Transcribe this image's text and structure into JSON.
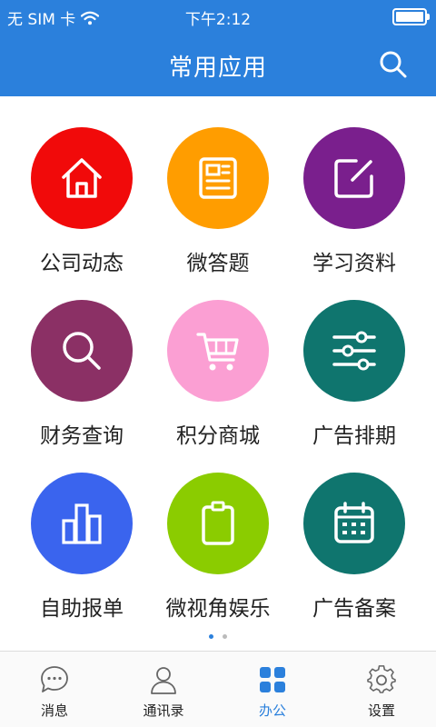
{
  "status_bar": {
    "carrier": "无 SIM 卡",
    "time": "下午2:12",
    "battery_level": 1.0
  },
  "header": {
    "title": "常用应用",
    "search_icon": "search-icon"
  },
  "apps": [
    {
      "label": "公司动态",
      "icon": "home-icon",
      "color": "#f10a0a"
    },
    {
      "label": "微答题",
      "icon": "form-icon",
      "color": "#ff9d00"
    },
    {
      "label": "学习资料",
      "icon": "edit-icon",
      "color": "#7a1f8d"
    },
    {
      "label": "财务查询",
      "icon": "search-icon",
      "color": "#8b3065"
    },
    {
      "label": "积分商城",
      "icon": "cart-icon",
      "color": "#fb9fd3"
    },
    {
      "label": "广告排期",
      "icon": "sliders-icon",
      "color": "#0f756e"
    },
    {
      "label": "自助报单",
      "icon": "bar-chart-icon",
      "color": "#3a64ee"
    },
    {
      "label": "微视角娱乐",
      "icon": "clipboard-icon",
      "color": "#8bcc00"
    },
    {
      "label": "广告备案",
      "icon": "calendar-icon",
      "color": "#0f756e"
    }
  ],
  "pager": {
    "pages": 2,
    "current": 1
  },
  "tabs": [
    {
      "label": "消息",
      "icon": "chat-bubble-icon",
      "active": false
    },
    {
      "label": "通讯录",
      "icon": "contacts-icon",
      "active": false
    },
    {
      "label": "办公",
      "icon": "grid-apps-icon",
      "active": true
    },
    {
      "label": "设置",
      "icon": "gear-icon",
      "active": false
    }
  ],
  "colors": {
    "primary": "#2b80dc",
    "tab_inactive": "#666666"
  }
}
